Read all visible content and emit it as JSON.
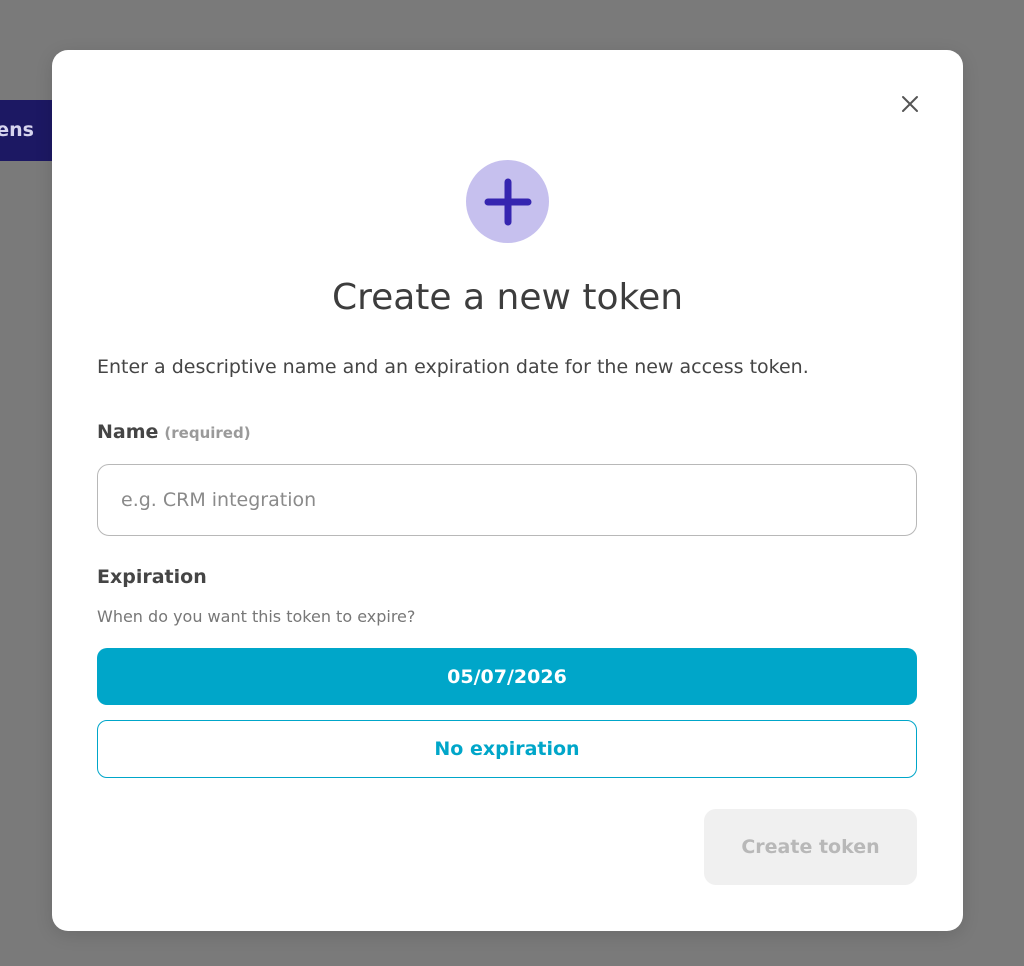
{
  "background": {
    "tab_label": "Tokens"
  },
  "modal": {
    "title": "Create a new token",
    "description": "Enter a descriptive name and an expiration date for the new access token.",
    "close_icon": "close-icon",
    "header_icon": "plus-icon",
    "name_field": {
      "label": "Name",
      "required_note": "(required)",
      "placeholder": "e.g. CRM integration",
      "value": ""
    },
    "expiration": {
      "label": "Expiration",
      "hint": "When do you want this token to expire?",
      "options": [
        {
          "label": "05/07/2026",
          "selected": true
        },
        {
          "label": "No expiration",
          "selected": false
        }
      ]
    },
    "submit_label": "Create token",
    "submit_disabled": true
  },
  "colors": {
    "accent": "#00a6c9",
    "brand_dark": "#1c1863",
    "icon_circle": "#c6c0ee",
    "icon_plus": "#3525b0",
    "overlay": "#7a7a7a"
  }
}
